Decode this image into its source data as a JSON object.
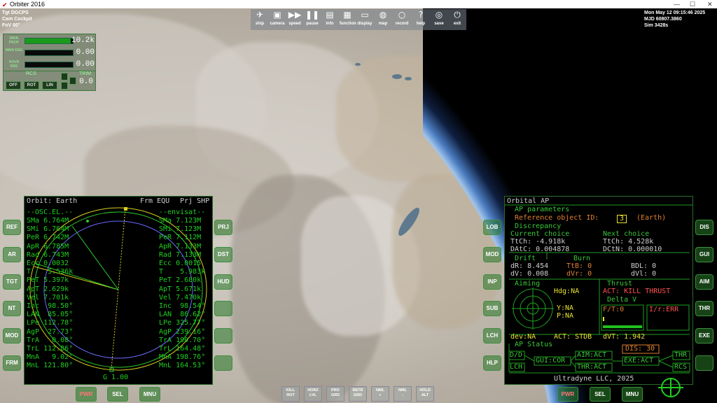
{
  "window": {
    "title": "Orbiter 2016"
  },
  "hud_topleft": {
    "target": "Tgt  DGCPS",
    "camera": "Cam Cockpit",
    "fov": "FoV  60°"
  },
  "hud_topright": {
    "date": "Mon May 12 09:15:46 2025",
    "mjd": "MJD  60807.3860",
    "sim": "Sim   3428s"
  },
  "toolbar": [
    {
      "label": "ship",
      "icon": "✈"
    },
    {
      "label": "camera",
      "icon": "▣"
    },
    {
      "label": "speed",
      "icon": "▶▶"
    },
    {
      "label": "pause",
      "icon": "❚❚"
    },
    {
      "label": "info",
      "icon": "▤"
    },
    {
      "label": "function",
      "icon": "▦"
    },
    {
      "label": "display",
      "icon": "▭"
    },
    {
      "label": "map",
      "icon": "◍"
    },
    {
      "label": "record",
      "icon": "○"
    },
    {
      "label": "help",
      "icon": "?"
    },
    {
      "label": "save",
      "icon": "◎"
    },
    {
      "label": "exit",
      "icon": "⏻"
    }
  ],
  "engines": [
    {
      "label": "MAIN PROP",
      "value": "10.2k",
      "fill": 0.95
    },
    {
      "label": "MAIN ENG",
      "value": "0.00",
      "fill": 0
    },
    {
      "label": "HOVR ENG",
      "value": "0.00",
      "fill": 0
    }
  ],
  "rcs": {
    "label": "RCS",
    "trim_label": "TRIM",
    "trim_value": "0.0",
    "buttons": [
      "OFF",
      "ROT",
      "LIN"
    ]
  },
  "left_mfd": {
    "header": "Orbit: Earth",
    "frm": "Frm EQU",
    "prj": "Prj SHP",
    "left_title": "--OSC.EL.--",
    "right_title": "--envisat--",
    "left_rows": [
      "SMa 6.764M",
      "SMi 6.764M",
      "PeR 6.742M",
      "ApR 6.785M",
      "Rad 6.743M",
      "Ecc 0.0032",
      "T    5.536k",
      "PeT 5.397k",
      "ApT 2.629k",
      "Vel 7.701k",
      "Inc  98.50°",
      "LAN  85.05°",
      "LPe 112.78°",
      "AgP  27.73°",
      "TrA   0.08°",
      "TrL 112.86°",
      "MnA   9.02°",
      "MnL 121.80°"
    ],
    "right_rows": [
      "SMa 7.123M",
      "SMi 7.123M",
      "PeR 7.112M",
      "ApR 7.133M",
      "Rad 7.133M",
      "Ecc 0.0015",
      "T    5.983k",
      "PeT 2.680k",
      "ApT 5.671k",
      "Vel 7.470k",
      "Inc  98.54°",
      "LAN  86.62°",
      "LPe 325.77°",
      "AgP 239.16°",
      "TrA 190.70°",
      "TrL 164.48°",
      "MnA 198.76°",
      "MnL 164.53°"
    ],
    "footer": "G 1.00",
    "side_left": [
      "REF",
      "AR",
      "TGT",
      "NT",
      "MOD",
      "FRM"
    ],
    "side_right": [
      "PRJ",
      "DST",
      "HUD",
      "",
      "",
      ""
    ]
  },
  "right_mfd": {
    "header": "Orbital AP",
    "ap_parameters": "AP parameters",
    "ref_label": "Reference object ID:",
    "ref_id": "3",
    "ref_name": "(Earth)",
    "discrepancy": "Discrepancy",
    "current_choice": "Current choice",
    "next_choice": "Next choice",
    "ttch_cur": "TtCh: -4.918k",
    "ttch_next": "TtCh: 4.528k",
    "datc": "DAtC: 0.004878",
    "dctn": "DCtN: 0.000010",
    "drift": "Drift",
    "burn": "Burn",
    "dr": "dR: 8.454",
    "tb": "TtB: 0",
    "bdl": "BDL: 0",
    "dv": "dV: 0.008",
    "dvr": "dVr: 0",
    "dvl": "dVl: 0",
    "aiming": "Aiming",
    "hdg": "Hdg:NA",
    "y": "Y:NA",
    "p": "P:NA",
    "dev": "dev:NA",
    "thrust": "Thrust",
    "act": "ACT: KILL THRUST",
    "delta_v": "Delta V",
    "ft": "F/T:0",
    "ir": "I/r:ERR",
    "act_stdb": "ACT: STDB",
    "dvt": "dVT: 1.942",
    "ap_status": "AP Status",
    "dis": "DIS: 30",
    "dd": "D/D",
    "lch": "LCH",
    "gui": "GUI:COR",
    "aim": "AIM:ACT",
    "thr": "THR:ACT",
    "exe": "EXE:ACT",
    "thr2": "THR",
    "rcs2": "RCS",
    "footer": "Ultradyne LLC, 2025",
    "side_left": [
      "LOB",
      "MOD",
      "INP",
      "SUB",
      "LCH",
      "HLP"
    ],
    "side_right": [
      "DIS",
      "GUI",
      "AIM",
      "THR",
      "EXE",
      ""
    ]
  },
  "bottom_left_buttons": [
    "PWR",
    "SEL",
    "MNU"
  ],
  "bottom_right_buttons": [
    "PWR",
    "SEL",
    "MNU"
  ],
  "commands": [
    {
      "top": "KILL",
      "bot": "ROT"
    },
    {
      "top": "HORZ",
      "bot": "LVL"
    },
    {
      "top": "PRO",
      "bot": "GRD"
    },
    {
      "top": "RETR",
      "bot": "GRD"
    },
    {
      "top": "NML",
      "bot": "+"
    },
    {
      "top": "NML",
      "bot": "-"
    },
    {
      "top": "HOLD",
      "bot": "ALT"
    }
  ]
}
